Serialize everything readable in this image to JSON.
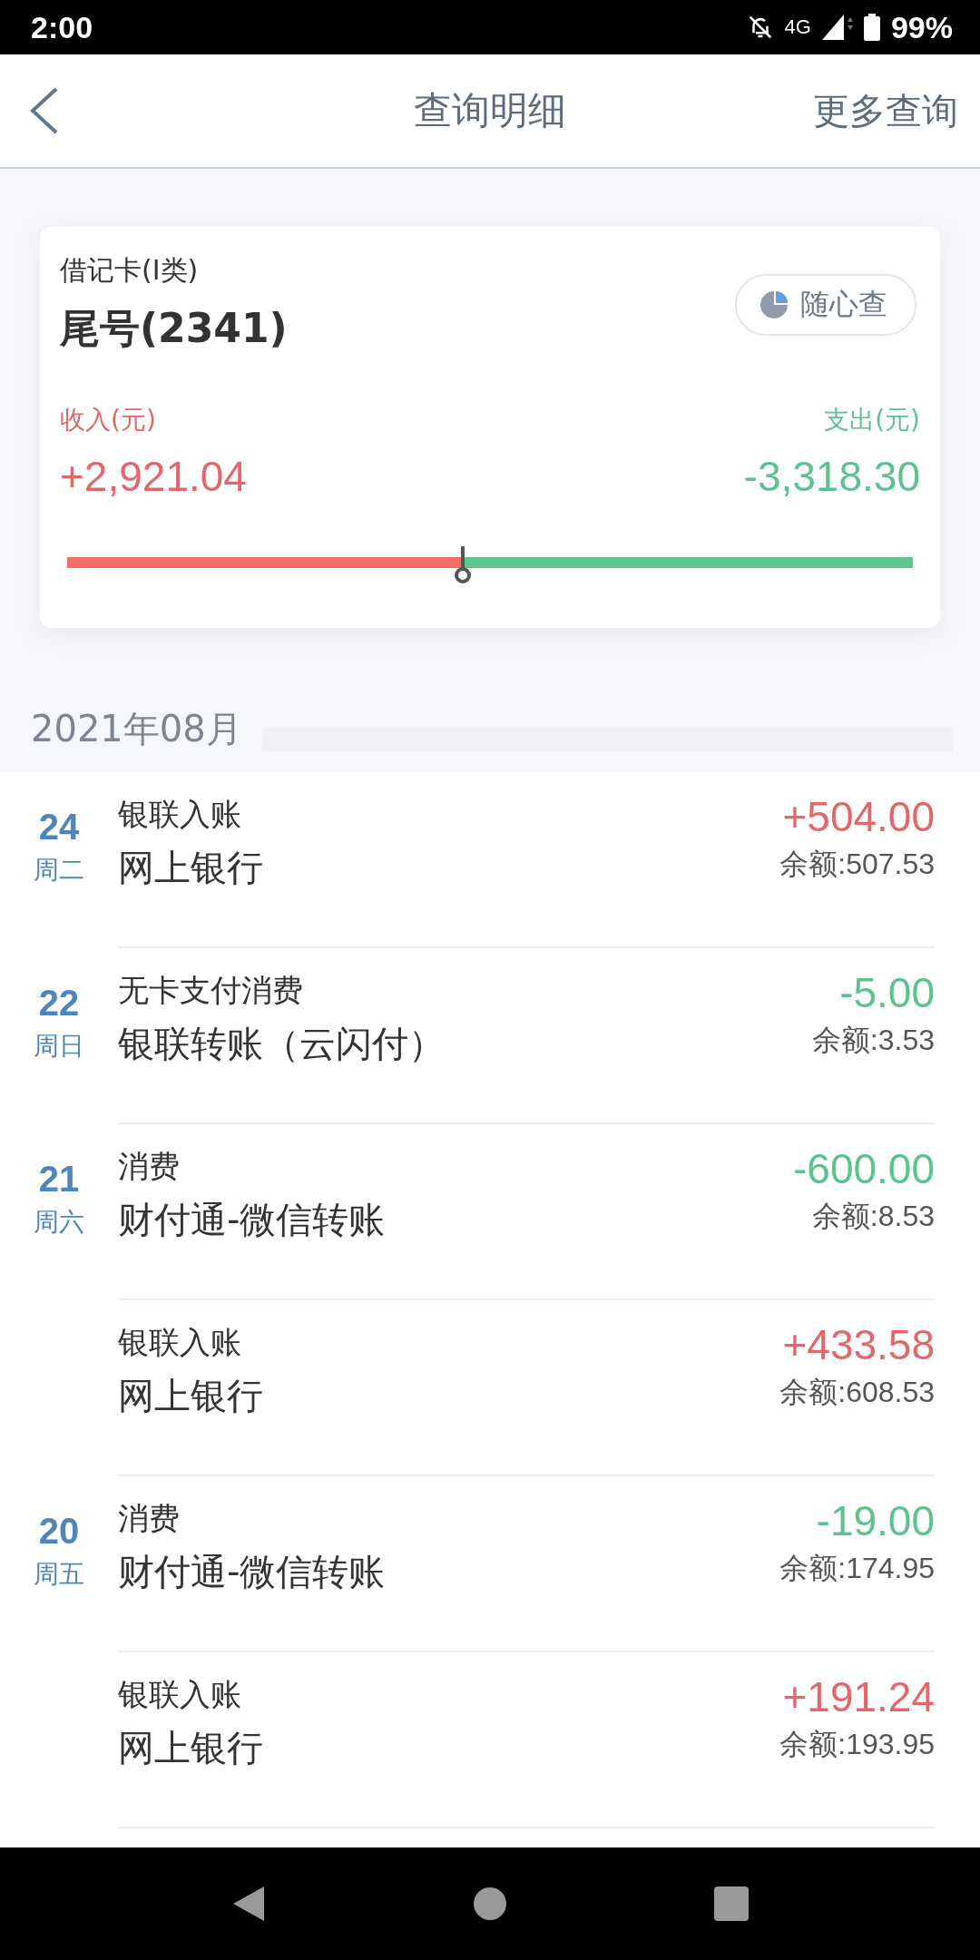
{
  "status_bar": {
    "time": "2:00",
    "network": "4G",
    "battery": "99%"
  },
  "header": {
    "title": "查询明细",
    "action": "更多查询"
  },
  "account": {
    "type": "借记卡(I类)",
    "number": "尾号(2341)",
    "button": "随心查",
    "income_label": "收入(元)",
    "income": "+2,921.04",
    "expense_label": "支出(元)",
    "expense": "-3,318.30",
    "level": 0.468
  },
  "month": "2021年08月",
  "transactions": [
    {
      "day": "24",
      "weekday": "周二",
      "kind": "income",
      "category": "银联入账",
      "channel": "网上银行",
      "amount": "+504.00",
      "balance": "余额:507.53"
    },
    {
      "day": "22",
      "weekday": "周日",
      "kind": "expense",
      "category": "无卡支付消费",
      "channel": "银联转账（云闪付）",
      "amount": "-5.00",
      "balance": "余额:3.53"
    },
    {
      "day": "21",
      "weekday": "周六",
      "kind": "expense",
      "category": "消费",
      "channel": "财付通-微信转账",
      "amount": "-600.00",
      "balance": "余额:8.53"
    },
    {
      "kind": "income",
      "category": "银联入账",
      "channel": "网上银行",
      "amount": "+433.58",
      "balance": "余额:608.53"
    },
    {
      "day": "20",
      "weekday": "周五",
      "kind": "expense",
      "category": "消费",
      "channel": "财付通-微信转账",
      "amount": "-19.00",
      "balance": "余额:174.95"
    },
    {
      "kind": "income",
      "category": "银联入账",
      "channel": "网上银行",
      "amount": "+191.24",
      "balance": "余额:193.95"
    }
  ]
}
